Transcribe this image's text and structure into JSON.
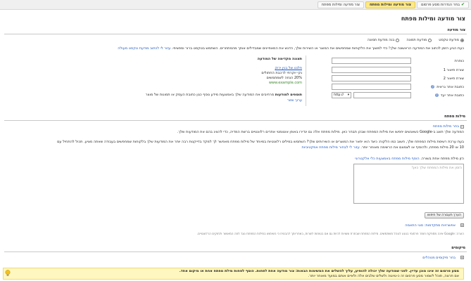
{
  "steps": [
    {
      "label": "בחר הגדרות מסע פרסום",
      "done": true
    },
    {
      "label": "צור מודעה ומילות מפתח",
      "active": true
    },
    {
      "label": "צור מודעה ומילות מפתח",
      "active": false
    }
  ],
  "page_title": "צור מודעה ומילות מפתח",
  "ad_section": {
    "heading": "צור מודעה",
    "radio_options": [
      "מודעת טקסט",
      "מודעת תמונה",
      "בנה מודעת תמונה"
    ],
    "selected": "מודעת טקסט",
    "instructions_text": "כעת הגיע הזמן לכתוב את המודעה הראשונה שלך! כדי למשוך את הלקוחות שמחפשים את המוצר או השירות שלך, הדגש את המאפיינים שמבדילים אותך מהמתחרים. השתמש בטקסט ברור וספציפי.",
    "instructions_link": "עזור לי לכתוב מודעת טקסט מעולה",
    "fields": [
      {
        "label": "כותרת"
      },
      {
        "label": "שורת תיאור 1"
      },
      {
        "label": "שורת תיאור 2"
      },
      {
        "label": "כתובת אתר גראית"
      },
      {
        "label": "כתובת אתר יעד"
      }
    ],
    "protocol": "http://",
    "preview_title": "תצוגה מקדימה של המודעה",
    "preview": {
      "title": "פלנט של בנין ירוק",
      "line1": "נקי יוקרתי לרכבת החתולים",
      "line2": "20% הנחה לשמתמשים",
      "url": "www.example.com"
    },
    "extensions_label": "תוספים למודעות",
    "extensions_desc": "מרחיבים את המודעה שלך באמצעות מידע נוסף כגון כתובת העסק או תמונות של מוצר",
    "extensions_link": "ערוך שזור"
  },
  "keywords_section": {
    "heading": "מילות מפתח",
    "toggle_label": "בחר מילות מפתח",
    "para1": "המודעה שלך תוצג ב-Google כשאנשים יחפשו את מילות המפתח שבהן תבחר כאן. מילות מפתח אלה גם יגדירו באופן אוטומטי אתרים רלוונטיים ברשת המדיה, כדי להציג בהם את המודעות שלך.",
    "para2a": "בעת ערכת רשימת מילות המפתח שלך, חשוב כמו הלקוח: כיצד הוא יתאר את המוצרים או השירותים שלך? השתמש במילים רלוונטיות במיוחד של מילות מפתח מאפשר לך למקד בדייקנות רבה יותר את המודעות שלך בלקוחות שמחפשים בעבודה שאתה מציע. תכול להתחיל עם",
    "para2b": "10 או 20 מילות מפתח, ולהוסיף או לצמצם את הרשימה מאוחר יותר.",
    "para2_link": "עזור לי לבחור מילות מפתח אפקטיביות",
    "para3": "הזן מילת מפתח אחת בשורה.",
    "para3_link": "הוסף מילות מפתח באמצעות כלי אלקטרוני",
    "textarea_placeholder": "הזמן את מילות המפתח שלך כאן!",
    "button_label": "הערך תעבורה של חיפוש",
    "advanced_link": "אפשרויות מתקדמות: סוגי התאמה",
    "note": "הערה: Google אינה מספקת חומר פרסומי בנוגע לנוהל משתמשים. מילות המפתח שבחרת עשויות להיות גם אם בטוחות לשרות, באחריותך להבטיח כי השימוש במילות המפתח נוגד לוזה המאושר ולחוקים הרלוונטיים."
  },
  "targeting": {
    "heading": "מיקומים",
    "link": "בחר מיקומים מנוהלים"
  },
  "banner": {
    "line1": "מסע פרסום זה אינו מוכן עדיין. לפני שמודעה שלך יכולה להופיע, עליך להשלים את המשימות הבאות: צור מודעה אחת לפחות. הוסף לפחות מילת מפתח אחת או מיקום אחד.",
    "line2": "אם תרצה, תוכל לשמור מסע פרסום זה כ-טיוטה ולשלים שלבים אלה ולאיים אותם במועד מאוחר יותר."
  }
}
